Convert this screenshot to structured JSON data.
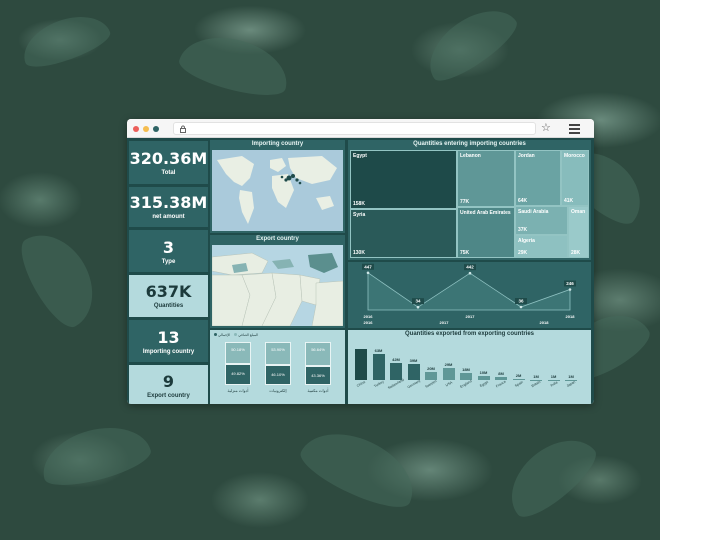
{
  "browser": {
    "window_controls": [
      "close",
      "minimize",
      "maximize"
    ],
    "colors": {
      "close": "#ec5f5a",
      "minimize": "#f5bd4f",
      "maximize": "#2f6465"
    }
  },
  "kpis": [
    {
      "value": "320.36M",
      "label": "Total"
    },
    {
      "value": "315.38M",
      "label": "net amount"
    },
    {
      "value": "3",
      "label": "Type"
    },
    {
      "value": "637K",
      "label": "Quantities"
    },
    {
      "value": "13",
      "label": "Importing country"
    },
    {
      "value": "9",
      "label": "Export country"
    }
  ],
  "panels": {
    "importing_map_title": "Importing country",
    "export_map_title": "Export country",
    "treemap_title": "Quantities entering importing countries",
    "exported_title": "Quantities exported from exporting countries"
  },
  "treemap": [
    {
      "name": "Egypt",
      "value": "158K"
    },
    {
      "name": "Syria",
      "value": "130K"
    },
    {
      "name": "Lebanon",
      "value": "77K"
    },
    {
      "name": "United Arab Emirates",
      "value": "75K"
    },
    {
      "name": "Jordan",
      "value": "64K"
    },
    {
      "name": "Saudi Arabia",
      "value": "37K"
    },
    {
      "name": "Algeria",
      "value": "29K"
    },
    {
      "name": "Morocco",
      "value": "41K"
    },
    {
      "name": "Oman",
      "value": "28K"
    }
  ],
  "stacked_legend": [
    "المبلغ الصافي",
    "الإجمالي"
  ],
  "stacked": [
    {
      "category": "أدوات منزلية",
      "top": "50.18%",
      "bottom": "49.82%"
    },
    {
      "category": "إلكترونيات",
      "top": "53.90%",
      "bottom": "46.10%"
    },
    {
      "category": "أدوات مكتبية",
      "top": "56.64%",
      "bottom": "43.36%"
    }
  ],
  "chart_data": [
    {
      "type": "area",
      "x": [
        "2016",
        "2016",
        "2017",
        "2017",
        "2018"
      ],
      "x_top": [
        "2016",
        "",
        "2017",
        "",
        "2018"
      ],
      "values": [
        447,
        34,
        442,
        36,
        246
      ],
      "labels": [
        "447",
        "34",
        "442",
        "36",
        "246"
      ],
      "ylim": [
        0,
        480
      ]
    },
    {
      "type": "bar",
      "title": "Quantities exported from exporting countries",
      "categories": [
        "China",
        "Turkey",
        "Switzerland",
        "Germany",
        "Sweden",
        "USA",
        "England",
        "Egypt",
        "France",
        "Spain",
        "Britain",
        "India",
        "Japan"
      ],
      "values": [
        75,
        63,
        42,
        39,
        20,
        29,
        18,
        10,
        8,
        2,
        1,
        1,
        1
      ],
      "labels": [
        "",
        "63M",
        "42M",
        "39M",
        "20M",
        "29M",
        "18M",
        "10M",
        "8M",
        "2M",
        "1M",
        "1M",
        "1M"
      ],
      "ylim": [
        0,
        80
      ]
    }
  ]
}
